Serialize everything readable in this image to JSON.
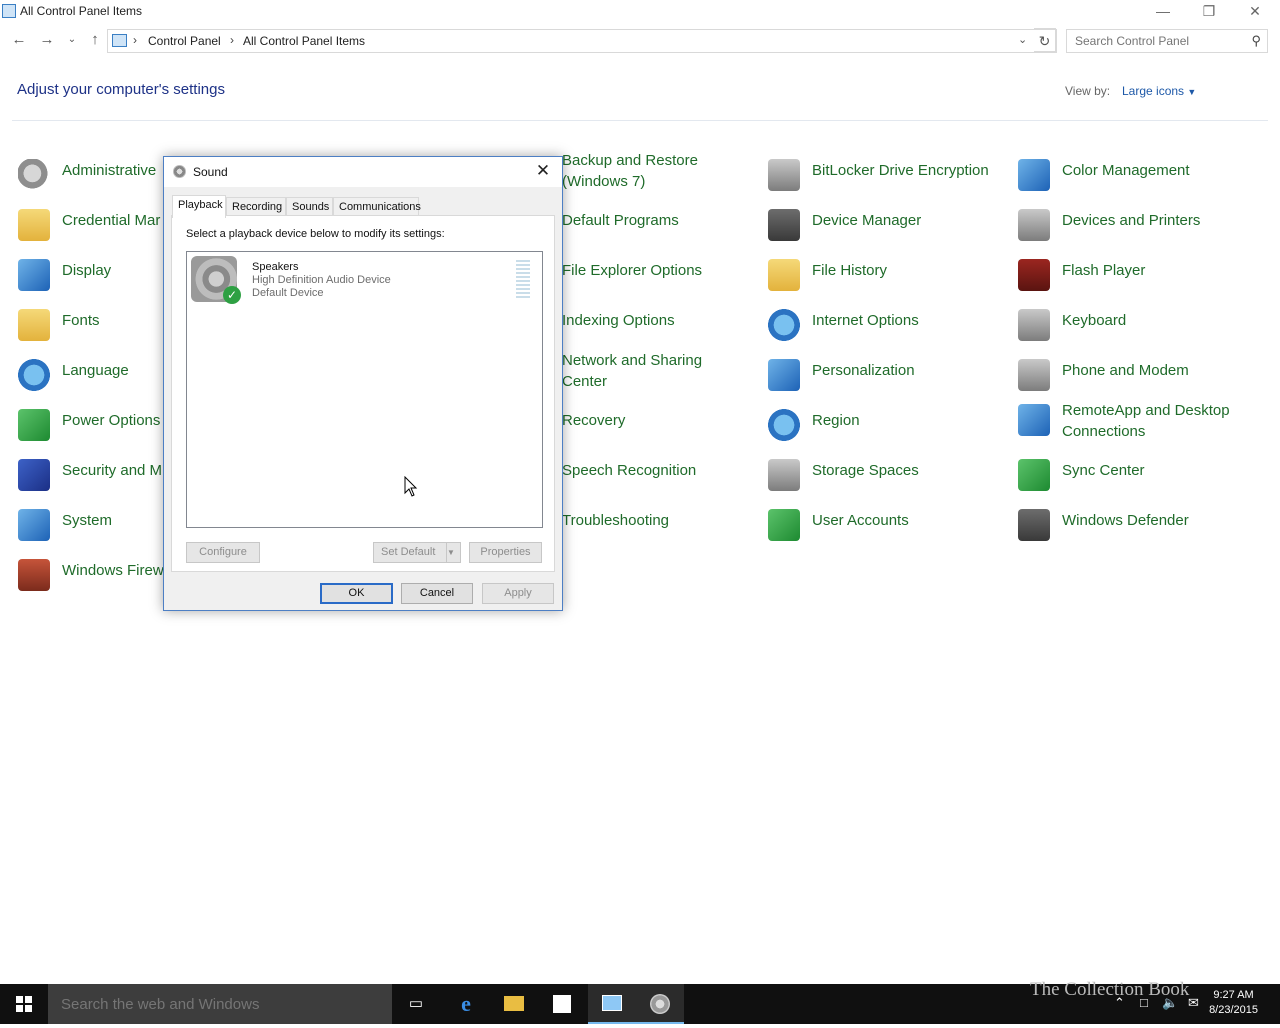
{
  "window": {
    "title": "All Control Panel Items"
  },
  "address": {
    "crumbs": [
      "Control Panel",
      "All Control Panel Items"
    ],
    "search_placeholder": "Search Control Panel"
  },
  "header": {
    "heading": "Adjust your computer's settings",
    "viewby_label": "View by:",
    "viewby_value": "Large icons"
  },
  "items": {
    "col1": [
      "Administrative",
      "Credential Mar",
      "Display",
      "Fonts",
      "Language",
      "Power Options",
      "Security and M",
      "System",
      "Windows Firew"
    ],
    "col3": [
      "Backup and Restore (Windows 7)",
      "Default Programs",
      "File Explorer Options",
      "Indexing Options",
      "Network and Sharing Center",
      "Recovery",
      "Speech Recognition",
      "Troubleshooting"
    ],
    "col4": [
      "BitLocker Drive Encryption",
      "Device Manager",
      "File History",
      "Internet Options",
      "Personalization",
      "Region",
      "Storage Spaces",
      "User Accounts"
    ],
    "col5": [
      "Color Management",
      "Devices and Printers",
      "Flash Player",
      "Keyboard",
      "Phone and Modem",
      "RemoteApp and Desktop Connections",
      "Sync Center",
      "Windows Defender"
    ]
  },
  "dialog": {
    "title": "Sound",
    "tabs": [
      "Playback",
      "Recording",
      "Sounds",
      "Communications"
    ],
    "instruction": "Select a playback device below to modify its settings:",
    "device": {
      "name": "Speakers",
      "line2": "High Definition Audio Device",
      "line3": "Default Device"
    },
    "configure": "Configure",
    "set_default": "Set Default",
    "properties": "Properties",
    "ok": "OK",
    "cancel": "Cancel",
    "apply": "Apply"
  },
  "taskbar": {
    "search_placeholder": "Search the web and Windows",
    "time": "9:27 AM",
    "date": "8/23/2015"
  },
  "watermark": "The Collection Book"
}
